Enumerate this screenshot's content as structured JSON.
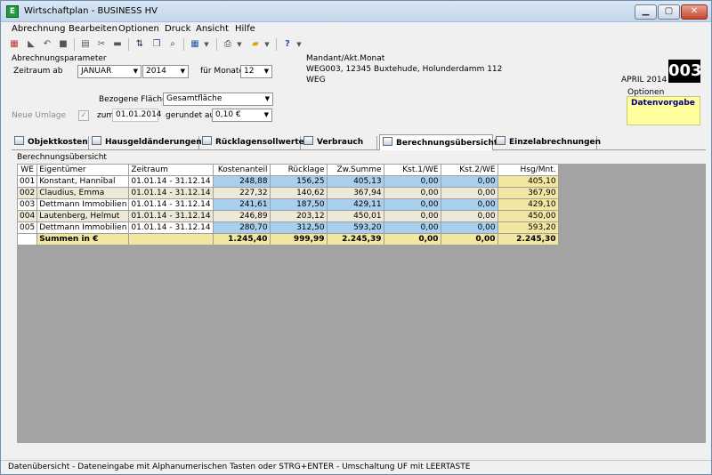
{
  "window": {
    "title": "Wirtschaftplan - BUSINESS HV",
    "app_icon": "E"
  },
  "menu": [
    "Abrechnung",
    "Bearbeiten",
    "Optionen",
    "Druck",
    "Ansicht",
    "Hilfe"
  ],
  "toolbar_icons": [
    "calendar-icon",
    "back-icon",
    "undo-icon",
    "stop-icon",
    "sort-icon",
    "copy-icon",
    "search-icon",
    "table-icon",
    "print-icon",
    "note-icon",
    "help-icon"
  ],
  "params": {
    "group_label": "Abrechnungsparameter",
    "zeitraum_label": "Zeitraum ab",
    "month": "JANUAR",
    "year": "2014",
    "fuer_monate_label": "für Monate",
    "months": "12",
    "flaeche_label": "Bezogene Fläche",
    "flaeche": "Gesamtfläche",
    "umlage_label": "Neue Umlage",
    "umlage_checked": "✓",
    "zum_label": "zum",
    "zum_date": "01.01.2014",
    "gerundet_label": "gerundet auf",
    "gerundet": "0,10 €"
  },
  "mandant": {
    "label": "Mandant/Akt.Monat",
    "line1": "WEG003, 12345 Buxtehude, Holunderdamm 112",
    "line2": "WEG",
    "month": "APRIL 2014",
    "code": "003"
  },
  "optionen": {
    "label": "Optionen",
    "value": "Datenvorgabe"
  },
  "tabs": [
    "Objektkosten",
    "Hausgeldänderungen",
    "Rücklagensollwerte",
    "Verbrauch",
    "Berechnungsübersicht",
    "Einzelabrechnungen"
  ],
  "active_tab": "Berechnungsübersicht",
  "section_title": "Berechnungsübersicht",
  "table": {
    "headers": [
      "WE",
      "Eigentümer",
      "Zeitraum",
      "Kostenanteil",
      "Rücklage",
      "Zw.Summe",
      "Kst.1/WE",
      "Kst.2/WE",
      "Hsg/Mnt."
    ],
    "rows": [
      [
        "001",
        "Konstant, Hannibal",
        "01.01.14 - 31.12.14",
        "248,88",
        "156,25",
        "405,13",
        "0,00",
        "0,00",
        "405,10"
      ],
      [
        "002",
        "Claudius, Emma",
        "01.01.14 - 31.12.14",
        "227,32",
        "140,62",
        "367,94",
        "0,00",
        "0,00",
        "367,90"
      ],
      [
        "003",
        "Dettmann Immobilien",
        "01.01.14 - 31.12.14",
        "241,61",
        "187,50",
        "429,11",
        "0,00",
        "0,00",
        "429,10"
      ],
      [
        "004",
        "Lautenberg, Helmut",
        "01.01.14 - 31.12.14",
        "246,89",
        "203,12",
        "450,01",
        "0,00",
        "0,00",
        "450,00"
      ],
      [
        "005",
        "Dettmann Immobilien",
        "01.01.14 - 31.12.14",
        "280,70",
        "312,50",
        "593,20",
        "0,00",
        "0,00",
        "593,20"
      ]
    ],
    "sum": {
      "label": "Summen in €",
      "kosten": "1.245,40",
      "ruecklage": "999,99",
      "zw": "2.245,39",
      "kst1": "0,00",
      "kst2": "0,00",
      "hsg": "2.245,30"
    }
  },
  "status": "Datenübersicht - Dateneingabe mit Alphanumerischen Tasten oder STRG+ENTER - Umschaltung UF mit LEERTASTE",
  "colors": {
    "highlight_blue": "#a9cfef",
    "highlight_yellow": "#f1e7a1",
    "options_yellow": "#ffff9e"
  }
}
